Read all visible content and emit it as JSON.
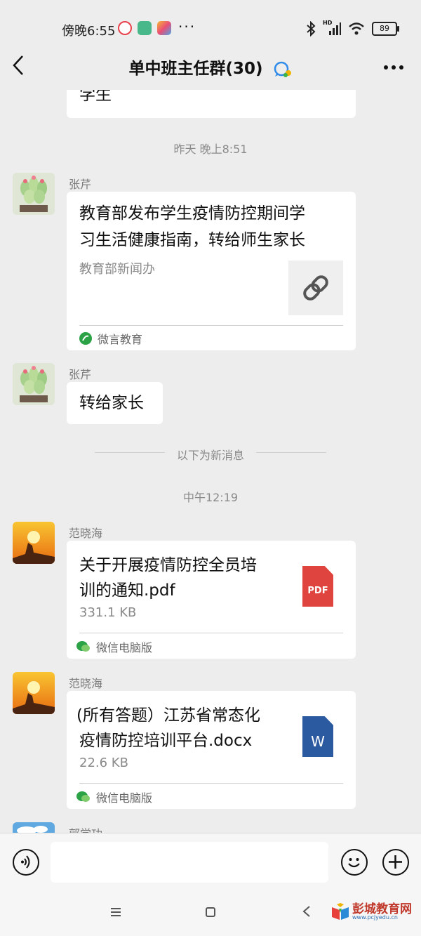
{
  "status_bar": {
    "time": "傍晚6:55",
    "dots": "···",
    "battery": "89",
    "network": "HD"
  },
  "header": {
    "title": "单中班主任群(30)"
  },
  "chat": {
    "prev_message_tail": "学生",
    "timestamp_1": "昨天 晚上8:51",
    "msg1": {
      "sender": "张芹",
      "title": "教育部发布学生疫情防控期间学习生活健康指南，转给师生家长",
      "title_line1": "教育部发布学生疫情防控期间学",
      "title_line2": "习生活健康指南，转给师生家长",
      "subtitle": "教育部新闻办",
      "source": "微言教育"
    },
    "msg2": {
      "sender": "张芹",
      "text": "转给家长"
    },
    "new_messages_divider": "以下为新消息",
    "timestamp_2": "中午12:19",
    "msg3": {
      "sender": "范晓海",
      "line1": "关于开展疫情防控全员培",
      "line2": "训的通知.pdf",
      "size": "331.1 KB",
      "file_icon_label": "PDF",
      "source": "微信电脑版"
    },
    "msg4": {
      "sender": "范晓海",
      "line1": "(所有答题）江苏省常态化",
      "line2": "疫情防控培训平台.docx",
      "size": "22.6 KB",
      "file_icon_label": "W",
      "source": "微信电脑版"
    },
    "msg5_sender_partial": "郭学功"
  },
  "watermark": {
    "title": "彭城教育网",
    "url": "www.pcjyedu.cn"
  },
  "colors": {
    "background": "#ededed",
    "pdf_red": "#e0443e",
    "word_blue": "#2b5aa0",
    "wechat_green": "#2ba245"
  }
}
